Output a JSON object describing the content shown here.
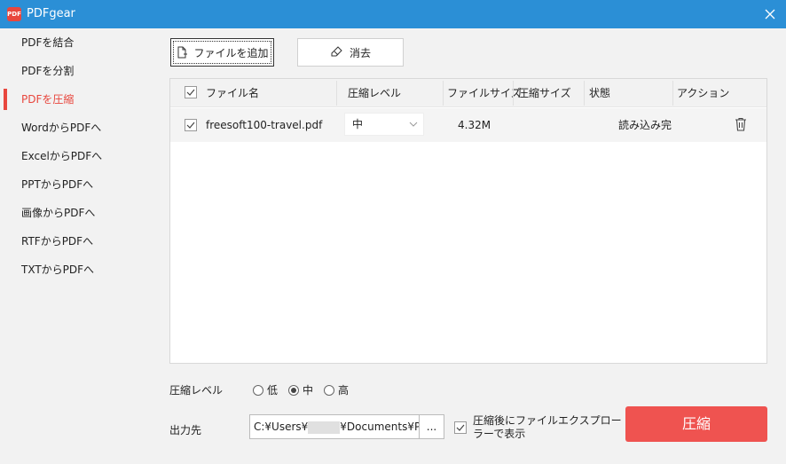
{
  "window": {
    "title": "PDFgear",
    "logo_text": "PDF"
  },
  "sidebar": {
    "items": [
      {
        "label": "PDFを結合"
      },
      {
        "label": "PDFを分割"
      },
      {
        "label": "PDFを圧縮"
      },
      {
        "label": "WordからPDFへ"
      },
      {
        "label": "ExcelからPDFへ"
      },
      {
        "label": "PPTからPDFへ"
      },
      {
        "label": "画像からPDFへ"
      },
      {
        "label": "RTFからPDFへ"
      },
      {
        "label": "TXTからPDFへ"
      }
    ],
    "active_index": 2
  },
  "toolbar": {
    "add_label": "ファイルを追加",
    "clear_label": "消去"
  },
  "table": {
    "headers": [
      "ファイル名",
      "圧縮レベル",
      "ファイルサイズ",
      "圧縮サイズ",
      "状態",
      "アクション"
    ],
    "rows": [
      {
        "name": "freesoft100-travel.pdf",
        "level": "中",
        "size": "4.32M",
        "compressed": "",
        "status": "読み込み完"
      }
    ]
  },
  "options": {
    "level_label": "圧縮レベル",
    "levels": [
      "低",
      "中",
      "高"
    ],
    "selected_level": "中",
    "output_label": "出力先",
    "path_prefix": "C:¥Users¥",
    "path_suffix": "¥Documents¥PDFg",
    "browse_label": "...",
    "open_explorer_label": "圧縮後にファイルエクスプローラーで表示",
    "compress_label": "圧縮"
  },
  "colors": {
    "titlebar": "#2b8fd6",
    "accent": "#e8473e",
    "compress_button": "#ef5350"
  }
}
